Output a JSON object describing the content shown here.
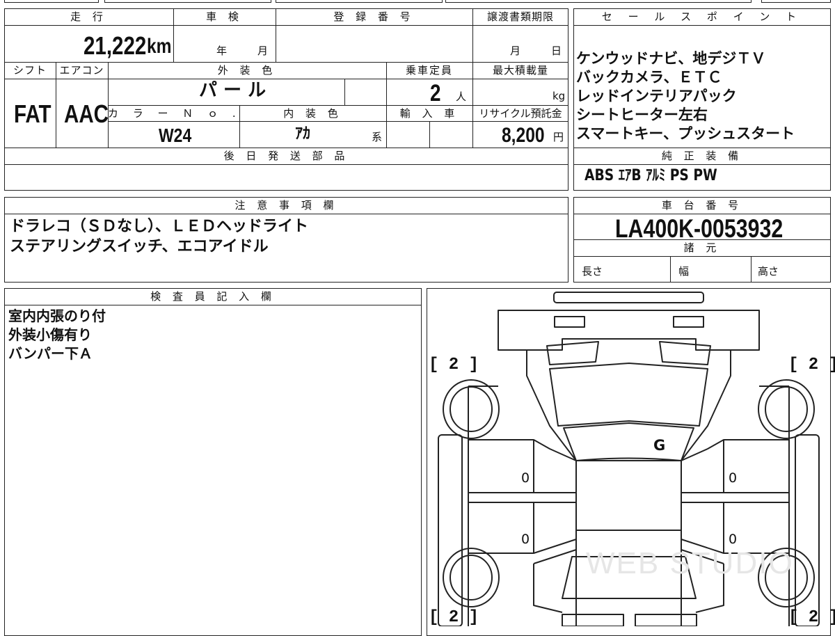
{
  "vehicle": {
    "mileage_header": "走 行",
    "mileage": "21,222",
    "mileage_unit": "km",
    "inspection_header": "車 検",
    "inspection_year": "年",
    "inspection_month": "月",
    "registration_header": "登 録 番 号",
    "transfer_header": "譲渡書類期限",
    "transfer_month": "月",
    "transfer_day": "日",
    "shift_header": "シフト",
    "shift": "FAT",
    "aircon_header": "エアコン",
    "aircon": "AAC",
    "exterior_header": "外 装 色",
    "exterior_color": "パ ー ル",
    "capacity_header": "乗車定員",
    "capacity": "2",
    "capacity_unit": "人",
    "max_load_header": "最大積載量",
    "max_load_unit": "kg",
    "color_no_header": "カ ラ ー Ｎ ｏ .",
    "color_no": "W24",
    "interior_header": "内 装 色",
    "interior_color": "ｱｶ",
    "interior_suffix": "系",
    "import_header": "輸 入 車",
    "recycle_header": "リサイクル預託金",
    "recycle_fee": "8,200",
    "recycle_unit": "円",
    "later_parts_header": "後 日 発 送 部 品"
  },
  "sales_points": {
    "header": "セ ー ル ス ポ イ ン ト",
    "lines": [
      "ケンウッドナビ、地デジＴＶ",
      "バックカメラ、ＥＴＣ",
      "レッドインテリアパック",
      "シートヒーター左右",
      "スマートキー、プッシュスタート"
    ]
  },
  "equipment": {
    "header": "純 正 装 備",
    "items": "ABS  ｴｱB  ｱﾙﾐ  PS  PW"
  },
  "notes": {
    "header": "注 意 事 項 欄",
    "lines": [
      "ドラレコ（ＳＤなし）、ＬＥＤヘッドライト",
      "ステアリングスイッチ、エコアイドル"
    ]
  },
  "chassis": {
    "header": "車 台 番 号",
    "number": "LA400K-0053932",
    "specs_header": "諸 元",
    "length_label": "長さ",
    "width_label": "幅",
    "height_label": "高さ"
  },
  "inspector": {
    "header": "検 査 員 記 入 欄",
    "lines": [
      "室内内張のり付",
      "外装小傷有り",
      "バンパー下Ａ"
    ]
  },
  "diagram": {
    "tire_fl": "[ 2 ]",
    "tire_fr": "[ 2 ]",
    "tire_rl": "[ 2 ]",
    "tire_rr": "[ 2 ]",
    "roof_mark": "G",
    "door_fl": "0",
    "door_rl": "0",
    "door_fr": "0",
    "door_rr": "0"
  }
}
